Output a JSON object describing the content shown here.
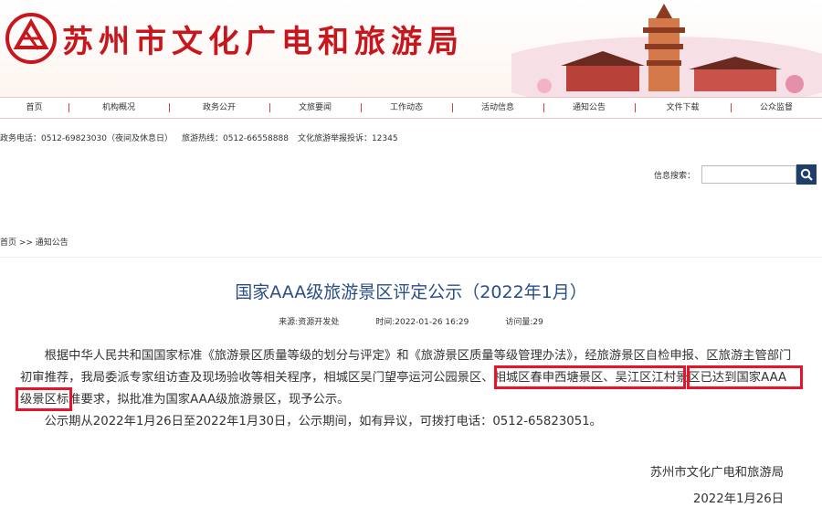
{
  "header": {
    "title": "苏州市文化广电和旅游局"
  },
  "nav": {
    "items": [
      {
        "label": "首页"
      },
      {
        "label": "机构概况"
      },
      {
        "label": "政务公开"
      },
      {
        "label": "文旅要闻"
      },
      {
        "label": "工作动态"
      },
      {
        "label": "活动信息"
      },
      {
        "label": "通知公告"
      },
      {
        "label": "文件下载"
      },
      {
        "label": "公众监督"
      }
    ]
  },
  "contact": {
    "gov_phone": "政务电话：0512-69823030（夜间及休息日）",
    "tour_phone": "旅游热线：0512-66558888",
    "complaint": "文化旅游举报投诉：12345"
  },
  "search": {
    "label": "信息搜索：",
    "value": ""
  },
  "breadcrumb": "首页 >> 通知公告",
  "article": {
    "title": "国家AAA级旅游景区评定公示（2022年1月）",
    "source": "来源:资源开发处",
    "time": "时间:2022-01-26 16:29",
    "views": "访问量:29",
    "para1_a": "根据中华人民共和国国家标准《旅游景区质量等级的划分与评定》和《旅游景区质量等级管理办法》，经旅游景区自检申报、区旅游主管部门初审推荐，我局委派专家组访查及现场验收等相关程序，",
    "spot1": "相城区吴门望亭运河公园景区",
    "sep1": "、",
    "spot2": "相城区春申西塘景区",
    "sep2": "、",
    "para1_b": "吴江区江村景区已达到国家AAA级景区标准要求，拟批准为国家AAA级旅游景区，现予公示。",
    "para2": "公示期从2022年1月26日至2022年1月30日，公示期间，如有异议，可拨打电话：0512-65823051。",
    "signature": "苏州市文化广电和旅游局",
    "date": "2022年1月26日"
  },
  "colors": {
    "brand_red": "#c8161d",
    "title_blue": "#2a4e86",
    "highlight": "#e8142c"
  }
}
